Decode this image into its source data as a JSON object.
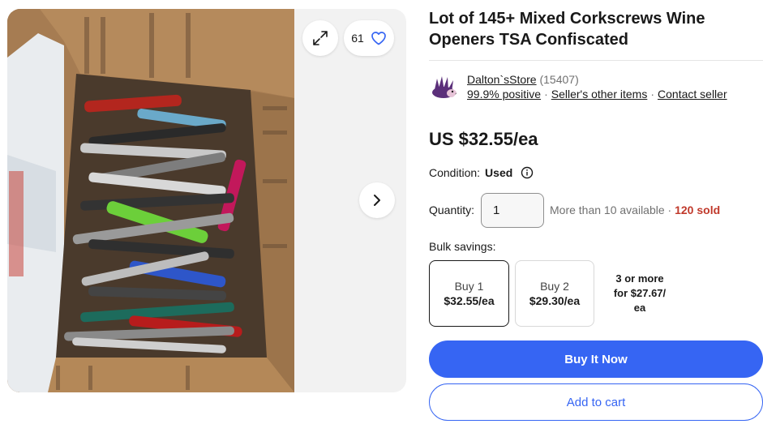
{
  "listing": {
    "title": "Lot of 145+ Mixed Corkscrews Wine Openers TSA Confiscated"
  },
  "gallery": {
    "watch_count": "61",
    "icons": {
      "expand": "expand-icon",
      "watch": "heart-icon",
      "next": "chevron-right-icon"
    }
  },
  "seller": {
    "name": "Dalton`sStore",
    "feedback_count": "(15407)",
    "positive": "99.9% positive",
    "other_items": "Seller's other items",
    "contact": "Contact seller"
  },
  "price": {
    "display": "US $32.55/ea"
  },
  "condition": {
    "label": "Condition:",
    "value": "Used"
  },
  "quantity": {
    "label": "Quantity:",
    "value": "1",
    "availability": "More than 10 available",
    "separator": "·",
    "sold": "120 sold"
  },
  "bulk": {
    "label": "Bulk savings:",
    "tiers": [
      {
        "line1": "Buy 1",
        "line2": "$32.55/ea"
      },
      {
        "line1": "Buy 2",
        "line2": "$29.30/ea"
      },
      {
        "line1": "3 or more",
        "line2": "for $27.67/",
        "line3": "ea"
      }
    ]
  },
  "actions": {
    "buy_now": "Buy It Now",
    "add_to_cart": "Add to cart"
  },
  "colors": {
    "primary": "#3665f3",
    "sold": "#c0392b",
    "text": "#191919",
    "muted": "#707070"
  }
}
